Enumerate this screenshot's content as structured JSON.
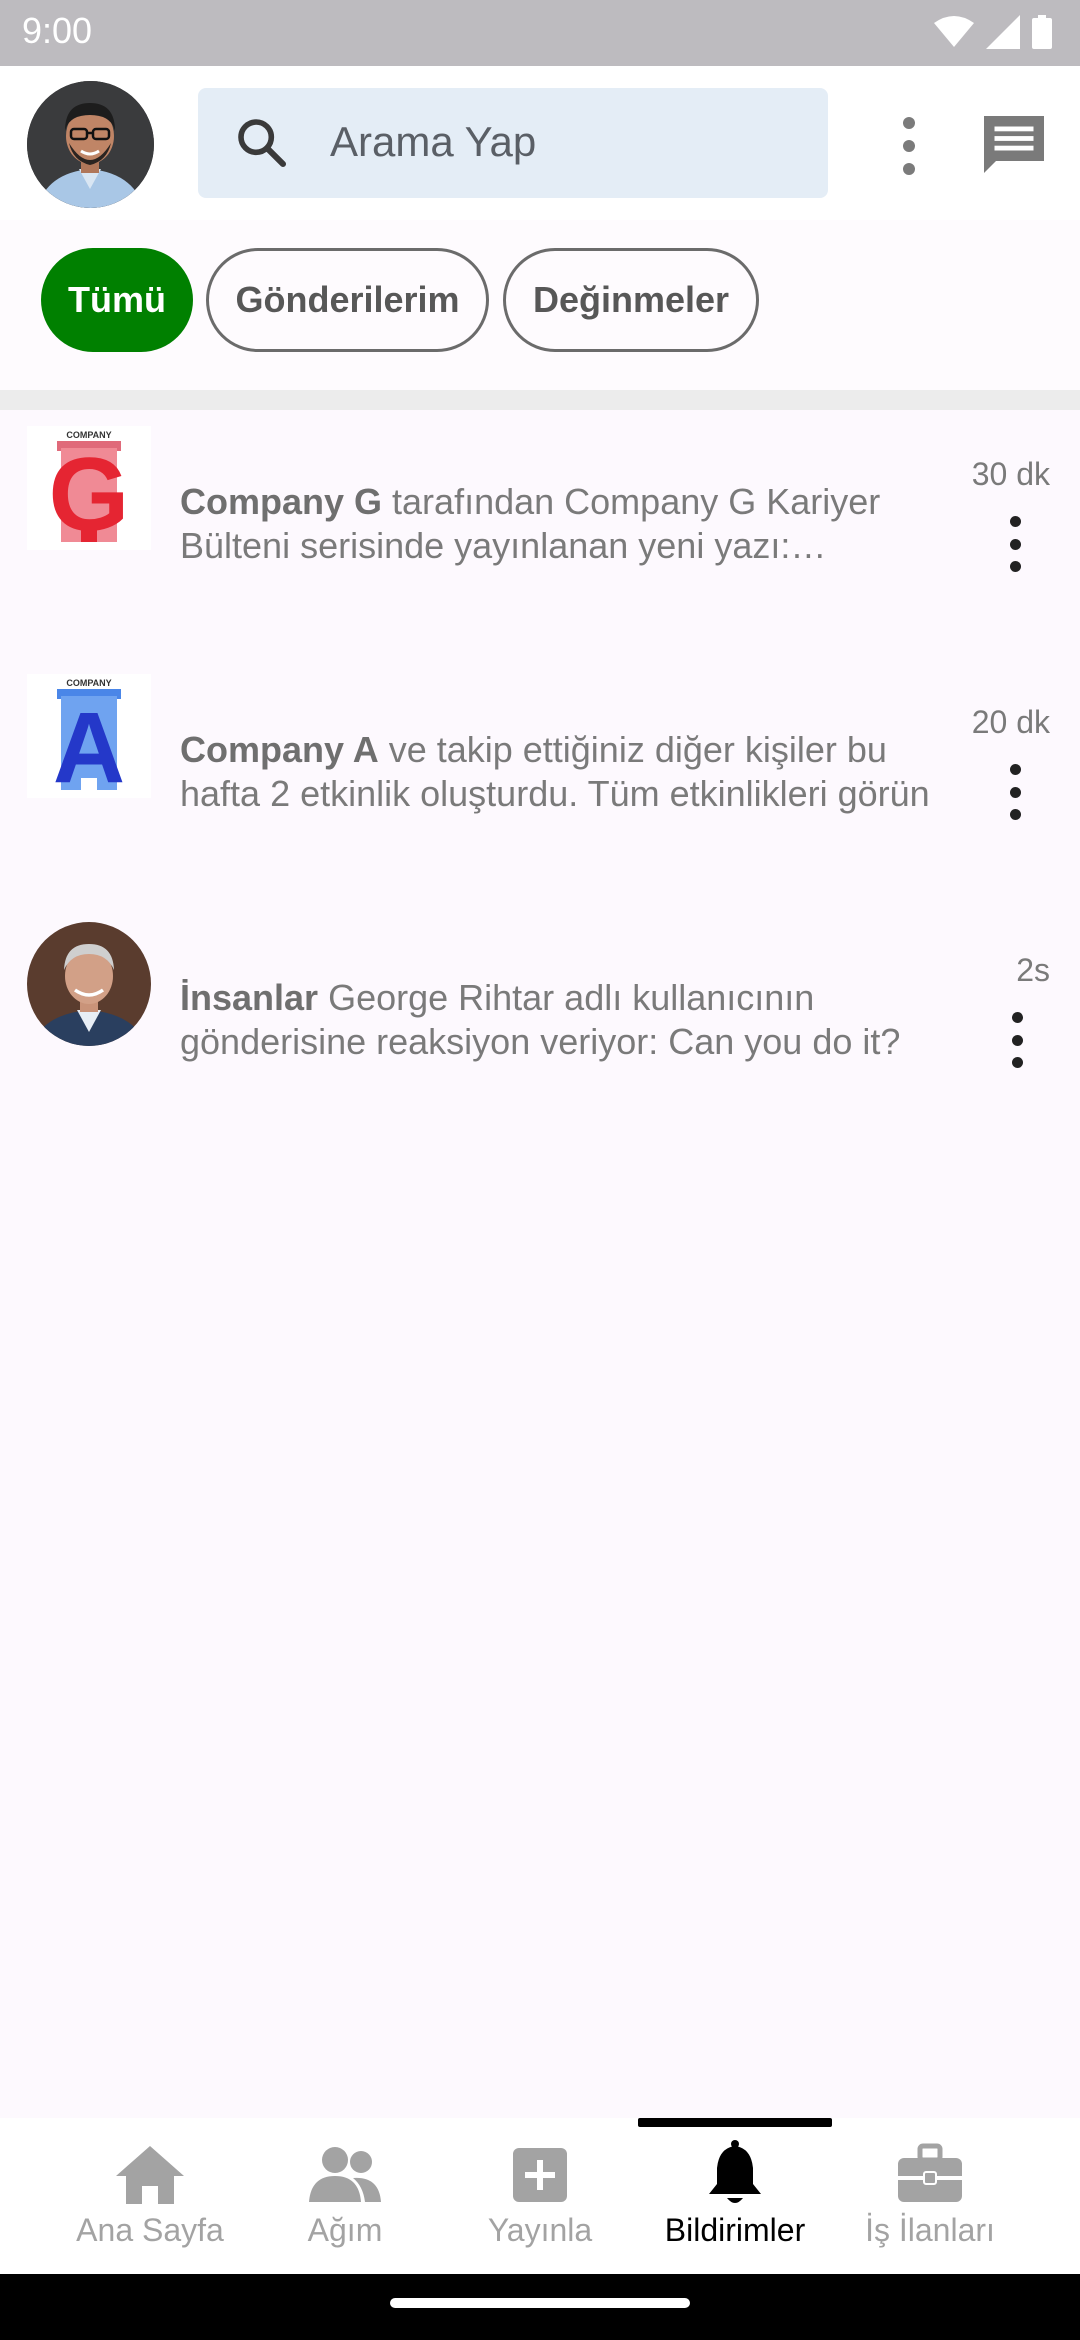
{
  "status_bar": {
    "time": "9:00"
  },
  "search": {
    "placeholder": "Arama Yap"
  },
  "filters": [
    {
      "label": "Tümü",
      "active": true
    },
    {
      "label": "Gönderilerim",
      "active": false
    },
    {
      "label": "Değinmeler",
      "active": false
    }
  ],
  "notifications": [
    {
      "actor": "Company G",
      "text": " tarafından Company G Kariyer Bülteni serisinde yayınlanan yeni yazı: Kariyer...",
      "time": "30 dk",
      "logo_caption": "COMPANY",
      "logo_letter": "G"
    },
    {
      "actor": "Company A",
      "text": " ve takip ettiğiniz diğer kişiler bu hafta 2 etkinlik oluşturdu. Tüm etkinlikleri görün",
      "time": "20 dk",
      "logo_caption": "COMPANY",
      "logo_letter": "A"
    },
    {
      "actor": "İnsanlar",
      "text": " George Rihtar adlı kullanıcının gönderisine reaksiyon veriyor: Can you do it?",
      "time": "2s"
    }
  ],
  "bottom_nav": [
    {
      "label": "Ana Sayfa",
      "icon": "home-icon"
    },
    {
      "label": "Ağım",
      "icon": "network-icon"
    },
    {
      "label": "Yayınla",
      "icon": "add-post-icon"
    },
    {
      "label": "Bildirimler",
      "icon": "bell-icon",
      "active": true
    },
    {
      "label": "İş İlanları",
      "icon": "briefcase-icon"
    }
  ]
}
